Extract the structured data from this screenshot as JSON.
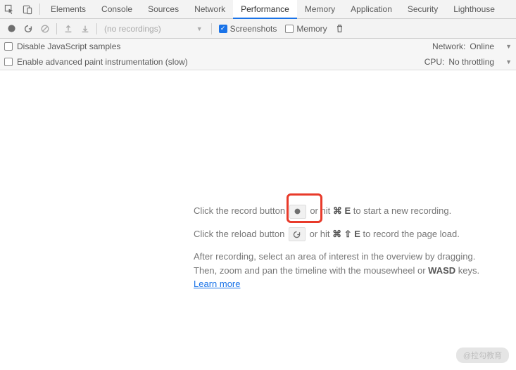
{
  "tabs": {
    "elements": "Elements",
    "console": "Console",
    "sources": "Sources",
    "network": "Network",
    "performance": "Performance",
    "memory": "Memory",
    "application": "Application",
    "security": "Security",
    "lighthouse": "Lighthouse"
  },
  "toolbar": {
    "recordings_placeholder": "(no recordings)",
    "screenshots_label": "Screenshots",
    "memory_label": "Memory"
  },
  "options": {
    "disable_js": "Disable JavaScript samples",
    "enable_paint": "Enable advanced paint instrumentation (slow)",
    "network_label": "Network:",
    "network_value": "Online",
    "cpu_label": "CPU:",
    "cpu_value": "No throttling"
  },
  "empty": {
    "line1_a": "Click the record button ",
    "line1_b": " or hit ",
    "line1_shortcut": "⌘ E",
    "line1_c": " to start a new recording.",
    "line2_a": "Click the reload button ",
    "line2_b": " or hit ",
    "line2_shortcut": "⌘ ⇧ E",
    "line2_c": " to record the page load.",
    "line3_a": "After recording, select an area of interest in the overview by dragging. Then, zoom and pan the timeline with the mousewheel or ",
    "line3_b": "WASD",
    "line3_c": " keys.",
    "learn_more": "Learn more"
  },
  "watermark": "@拉勾教育"
}
